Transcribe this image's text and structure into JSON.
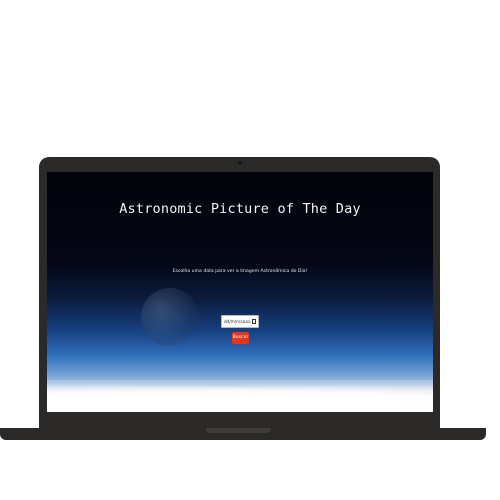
{
  "app": {
    "title": "Astronomic Picture of The Day",
    "instruction": "Escolha uma data para ver a Imagem Astronômica do Dia!"
  },
  "date_input": {
    "value": "dd/mm/aaaa",
    "icon": "calendar-icon"
  },
  "search_button": {
    "label": "Buscar"
  },
  "colors": {
    "button_bg": "#e2361f",
    "title_text": "#f4f4f4",
    "laptop_frame": "#2b2a28"
  }
}
